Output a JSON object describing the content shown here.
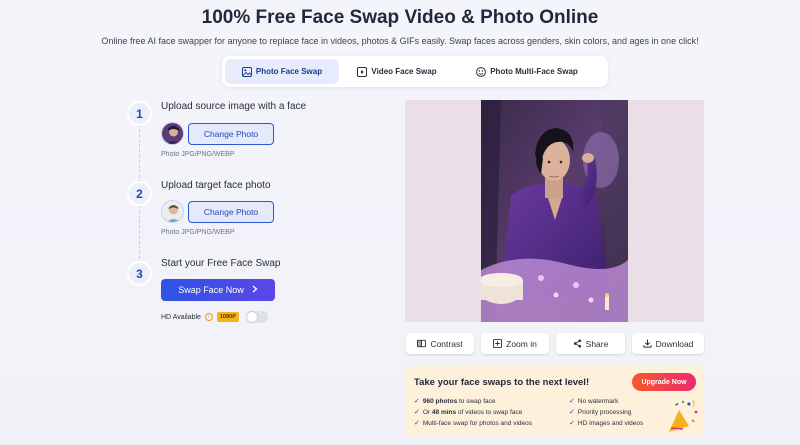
{
  "header": {
    "title": "100% Free Face Swap Video & Photo Online",
    "subtitle": "Online free AI face swapper for anyone to replace face in videos, photos & GIFs easily. Swap faces across genders, skin colors, and ages in one click!"
  },
  "tabs": [
    {
      "label": "Photo Face Swap",
      "icon": "image-icon",
      "active": true
    },
    {
      "label": "Video Face Swap",
      "icon": "video-icon",
      "active": false
    },
    {
      "label": "Photo Multi-Face Swap",
      "icon": "multi-face-icon",
      "active": false
    }
  ],
  "steps": [
    {
      "num": "1",
      "title": "Upload source image with a face",
      "button": "Change Photo",
      "hint": "Photo JPG/PNG/WEBP"
    },
    {
      "num": "2",
      "title": "Upload target face photo",
      "button": "Change Photo",
      "hint": "Photo JPG/PNG/WEBP"
    },
    {
      "num": "3",
      "title": "Start your Free Face Swap"
    }
  ],
  "swap_button": "Swap Face Now",
  "hd": {
    "label": "HD Available",
    "badge": "1080P",
    "enabled": false
  },
  "actions": [
    {
      "label": "Contrast",
      "icon": "contrast-icon"
    },
    {
      "label": "Zoom in",
      "icon": "zoom-icon"
    },
    {
      "label": "Share",
      "icon": "share-icon"
    },
    {
      "label": "Download",
      "icon": "download-icon"
    }
  ],
  "promo": {
    "title": "Take your face swaps to the next level!",
    "upgrade": "Upgrade Now",
    "features_left": [
      {
        "bold": "960 photos",
        "rest": " to swap face"
      },
      {
        "pre": "Or ",
        "bold": "48 mins",
        "rest": " of videos to swap face"
      },
      {
        "rest": "Multi-face swap for photos and videos"
      }
    ],
    "features_right": [
      "No watermark",
      "Priority processing",
      "HD images and videos"
    ]
  },
  "colors": {
    "accent": "#2f55d4",
    "swap_gradient_start": "#2c55e6",
    "swap_gradient_end": "#5d45e6",
    "upgrade_gradient_start": "#f5572f",
    "upgrade_gradient_end": "#ea2d6b",
    "promo_bg": "#fdf1dc"
  }
}
